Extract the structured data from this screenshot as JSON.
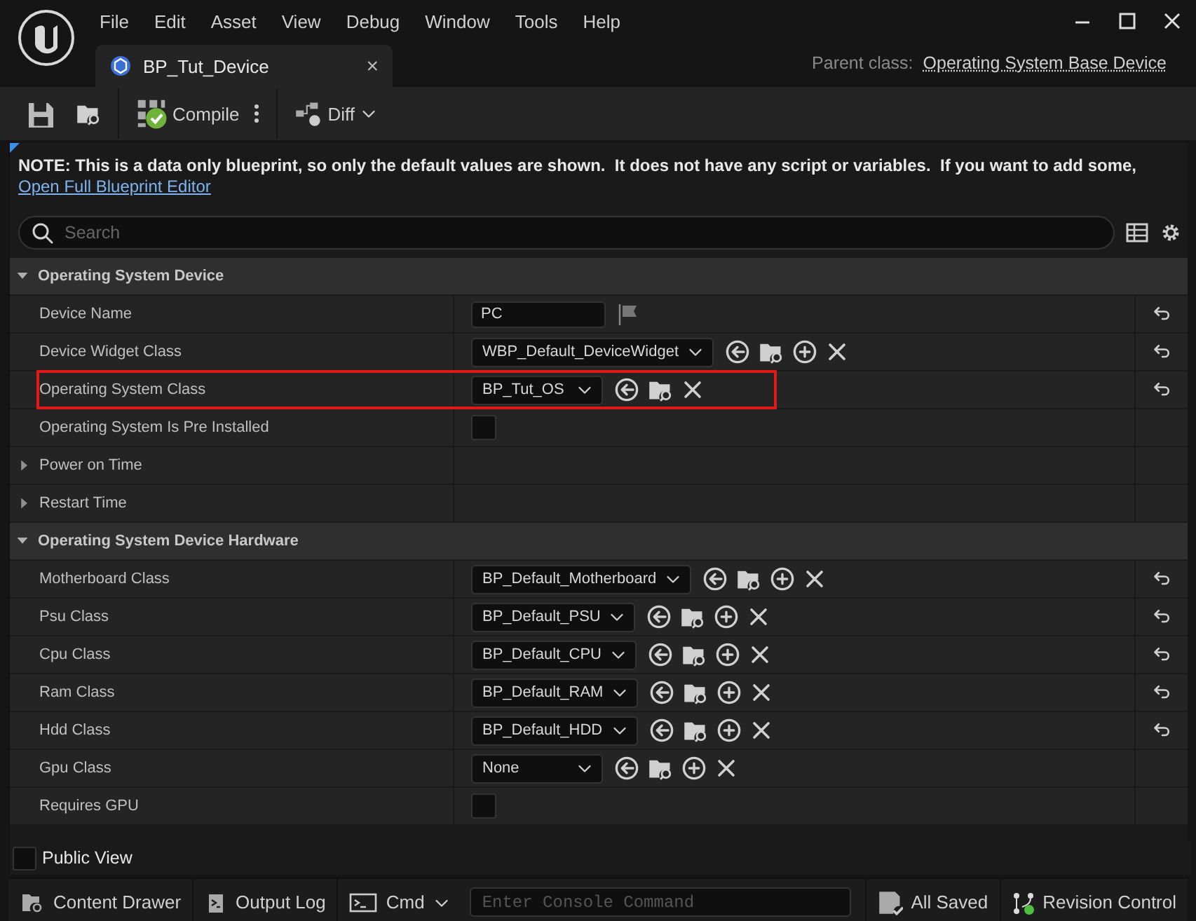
{
  "menu": [
    "File",
    "Edit",
    "Asset",
    "View",
    "Debug",
    "Window",
    "Tools",
    "Help"
  ],
  "tab": {
    "title": "BP_Tut_Device",
    "close": "×"
  },
  "parent_class": {
    "label": "Parent class:",
    "value": "Operating System Base Device"
  },
  "toolbar": {
    "compile": "Compile",
    "diff": "Diff"
  },
  "note": {
    "text": "NOTE: This is a data only blueprint, so only the default values are shown.  It does not have any script or variables.  If you want to add some,",
    "link": "Open Full Blueprint Editor"
  },
  "search": {
    "placeholder": "Search"
  },
  "categories": [
    {
      "title": "Operating System Device",
      "expanded": true,
      "rows": [
        {
          "kind": "text",
          "name": "Device Name",
          "value": "PC",
          "resettable": true,
          "highlighted": false
        },
        {
          "kind": "class",
          "name": "Device Widget Class",
          "value": "WBP_Default_DeviceWidget",
          "has_add": true,
          "resettable": true,
          "highlighted": false
        },
        {
          "kind": "class",
          "name": "Operating System Class",
          "value": "BP_Tut_OS",
          "has_add": false,
          "resettable": true,
          "highlighted": true
        },
        {
          "kind": "checkbox",
          "name": "Operating System Is Pre Installed",
          "checked": false,
          "resettable": false,
          "highlighted": false
        },
        {
          "kind": "struct",
          "name": "Power on Time",
          "expanded": false,
          "resettable": false,
          "highlighted": false
        },
        {
          "kind": "struct",
          "name": "Restart Time",
          "expanded": false,
          "resettable": false,
          "highlighted": false
        }
      ]
    },
    {
      "title": "Operating System Device Hardware",
      "expanded": true,
      "rows": [
        {
          "kind": "class",
          "name": "Motherboard Class",
          "value": "BP_Default_Motherboard",
          "has_add": true,
          "resettable": true,
          "highlighted": false
        },
        {
          "kind": "class",
          "name": "Psu Class",
          "value": "BP_Default_PSU",
          "has_add": true,
          "resettable": true,
          "highlighted": false
        },
        {
          "kind": "class",
          "name": "Cpu Class",
          "value": "BP_Default_CPU",
          "has_add": true,
          "resettable": true,
          "highlighted": false
        },
        {
          "kind": "class",
          "name": "Ram Class",
          "value": "BP_Default_RAM",
          "has_add": true,
          "resettable": true,
          "highlighted": false
        },
        {
          "kind": "class",
          "name": "Hdd Class",
          "value": "BP_Default_HDD",
          "has_add": true,
          "resettable": true,
          "highlighted": false
        },
        {
          "kind": "class",
          "name": "Gpu Class",
          "value": "None",
          "has_add": true,
          "resettable": false,
          "highlighted": false
        },
        {
          "kind": "checkbox",
          "name": "Requires GPU",
          "checked": false,
          "resettable": false,
          "highlighted": false
        }
      ]
    }
  ],
  "public_view": {
    "label": "Public View",
    "checked": false
  },
  "status_bar": {
    "content_drawer": "Content Drawer",
    "output_log": "Output Log",
    "cmd": "Cmd",
    "console_placeholder": "Enter Console Command",
    "saved": "All Saved",
    "revision": "Revision Control"
  }
}
